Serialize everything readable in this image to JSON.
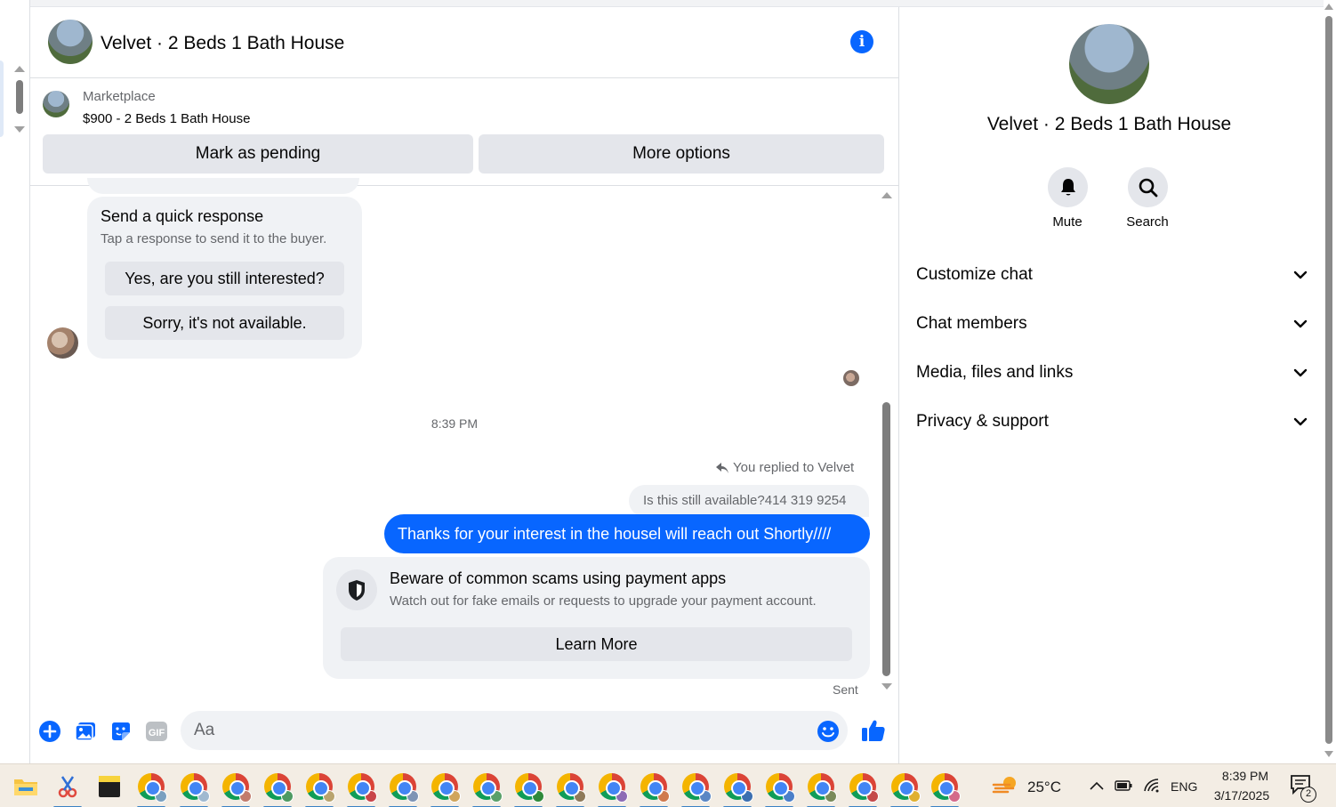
{
  "header": {
    "title": "Velvet · 2 Beds 1 Bath House"
  },
  "marketplace": {
    "label": "Marketplace",
    "listing": "$900 - 2 Beds 1 Bath House",
    "mark_pending": "Mark as pending",
    "more_options": "More options"
  },
  "quick_response": {
    "title": "Send a quick response",
    "subtitle": "Tap a response to send it to the buyer.",
    "options": [
      "Yes, are you still interested?",
      "Sorry, it's not available."
    ]
  },
  "conversation": {
    "timestamp": "8:39 PM",
    "replied_label": "You replied to Velvet",
    "replied_quote": "Is this still available?414 319 9254",
    "my_message": "Thanks for your interest in the housel will reach out Shortly////",
    "status": "Sent"
  },
  "scam_warning": {
    "title": "Beware of common scams using payment apps",
    "subtitle": "Watch out for fake emails or requests to upgrade your payment account.",
    "button": "Learn More"
  },
  "composer": {
    "placeholder": "Aa",
    "gif_label": "GIF"
  },
  "right_panel": {
    "title": "Velvet · 2 Beds 1 Bath House",
    "actions": [
      {
        "label": "Mute",
        "icon": "bell-icon"
      },
      {
        "label": "Search",
        "icon": "search-icon"
      }
    ],
    "sections": [
      "Customize chat",
      "Chat members",
      "Media, files and links",
      "Privacy & support"
    ]
  },
  "taskbar": {
    "weather": "25°C",
    "language": "ENG",
    "time": "8:39 PM",
    "date": "3/17/2025",
    "notification_count": "2",
    "accent": "#0866ff"
  }
}
